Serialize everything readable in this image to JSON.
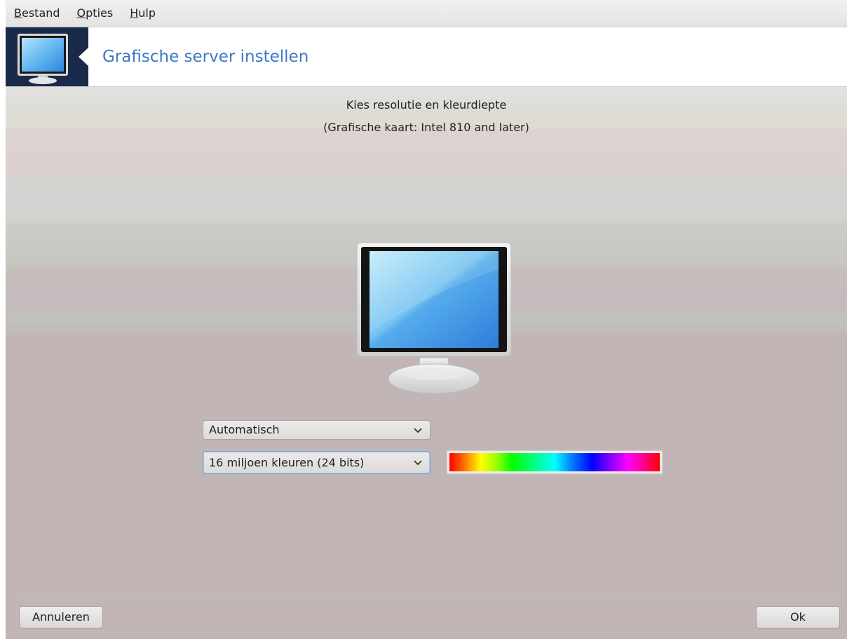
{
  "menubar": {
    "items": [
      {
        "first": "B",
        "rest": "estand"
      },
      {
        "first": "O",
        "rest": "pties"
      },
      {
        "first": "H",
        "rest": "ulp"
      }
    ]
  },
  "banner": {
    "title": "Grafische server instellen",
    "icon": "monitor-icon"
  },
  "main": {
    "instruction": "Kies resolutie en kleurdiepte",
    "card_info": "(Grafische kaart: Intel 810 and later)",
    "preview_icon": "monitor-icon",
    "resolution_select": {
      "value": "Automatisch"
    },
    "color_depth_select": {
      "value": "16 miljoen kleuren (24 bits)"
    },
    "color_preview": "color-spectrum"
  },
  "footer": {
    "cancel_label": "Annuleren",
    "ok_label": "Ok"
  },
  "colors": {
    "title_blue": "#3d78c6",
    "banner_dark": "#1a2a4a",
    "background": "#c1b5b5"
  }
}
